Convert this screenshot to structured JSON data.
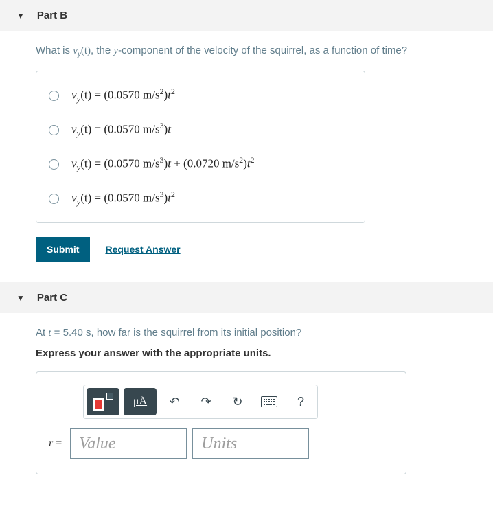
{
  "partB": {
    "title": "Part B",
    "question_prefix": "What is ",
    "question_var": "v",
    "question_sub": "y",
    "question_arg": "(t)",
    "question_mid": ", the ",
    "question_y": "y",
    "question_suffix": "-component of the velocity of the squirrel, as a function of time?",
    "choices": [
      {
        "lhs_v": "v",
        "lhs_sub": "y",
        "lhs_arg": "(t) = ",
        "a": "(0.0570 m/s",
        "a_exp": "2",
        "a2": ")",
        "t1": "t",
        "t1_exp": "2",
        "plus": "",
        "b": "",
        "b_exp": "",
        "b2": "",
        "t2": "",
        "t2_exp": ""
      },
      {
        "lhs_v": "v",
        "lhs_sub": "y",
        "lhs_arg": "(t) = ",
        "a": "(0.0570 m/s",
        "a_exp": "3",
        "a2": ")",
        "t1": "t",
        "t1_exp": "",
        "plus": "",
        "b": "",
        "b_exp": "",
        "b2": "",
        "t2": "",
        "t2_exp": ""
      },
      {
        "lhs_v": "v",
        "lhs_sub": "y",
        "lhs_arg": "(t) = ",
        "a": "(0.0570 m/s",
        "a_exp": "3",
        "a2": ")",
        "t1": "t",
        "t1_exp": "",
        "plus": " + ",
        "b": "(0.0720 m/s",
        "b_exp": "2",
        "b2": ")",
        "t2": "t",
        "t2_exp": "2"
      },
      {
        "lhs_v": "v",
        "lhs_sub": "y",
        "lhs_arg": "(t) = ",
        "a": "(0.0570 m/s",
        "a_exp": "3",
        "a2": ")",
        "t1": "t",
        "t1_exp": "2",
        "plus": "",
        "b": "",
        "b_exp": "",
        "b2": "",
        "t2": "",
        "t2_exp": ""
      }
    ],
    "submit": "Submit",
    "request": "Request Answer"
  },
  "partC": {
    "title": "Part C",
    "q1_prefix": "At ",
    "q1_t": "t",
    "q1_eq": " = 5.40 s",
    "q1_suffix": ", how far is the squirrel from its initial position?",
    "q2": "Express your answer with the appropriate units.",
    "ua_label": "μÅ",
    "help": "?",
    "r_eq_r": "r",
    "r_eq_eq": " =",
    "value_ph": "Value",
    "units_ph": "Units"
  }
}
